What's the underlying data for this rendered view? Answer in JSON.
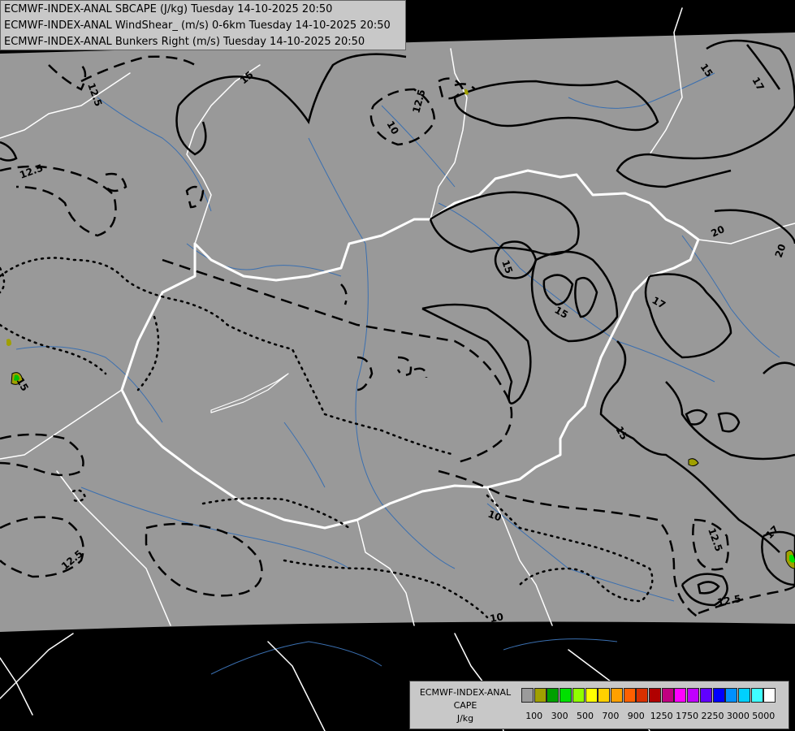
{
  "titles": [
    "ECMWF-INDEX-ANAL SBCAPE (J/kg) Tuesday 14-10-2025 20:50",
    "ECMWF-INDEX-ANAL WindShear_ (m/s) 0-6km Tuesday 14-10-2025 20:50",
    "ECMWF-INDEX-ANAL Bunkers Right (m/s) Tuesday 14-10-2025 20:50"
  ],
  "legend": {
    "line1": "ECMWF-INDEX-ANAL",
    "line2": "CAPE",
    "line3": "J/kg",
    "ticks": [
      "100",
      "300",
      "500",
      "700",
      "900",
      "1250",
      "1750",
      "2250",
      "3000",
      "5000"
    ],
    "colors": [
      "#9b9b9b",
      "#a0a000",
      "#00a000",
      "#00e000",
      "#90ff00",
      "#ffff00",
      "#ffd000",
      "#ffa000",
      "#ff6000",
      "#d83000",
      "#b00000",
      "#c00080",
      "#ff00ff",
      "#c000ff",
      "#6000ff",
      "#0000ff",
      "#0090ff",
      "#00d0ff",
      "#40ffff",
      "#ffffff"
    ]
  },
  "contour_labels": [
    "12.5",
    "15",
    "15",
    "12.5",
    "10",
    "12.5",
    "15",
    "17",
    "20",
    "20",
    "17",
    "15",
    "15",
    "10",
    "12.5",
    "12.5",
    "12.5",
    "17",
    "10",
    "15"
  ],
  "colors": {
    "background": "#000000",
    "data_domain": "#999999",
    "borders": "#ffffff",
    "rivers": "#3a6fb0",
    "contours": "#000000"
  }
}
